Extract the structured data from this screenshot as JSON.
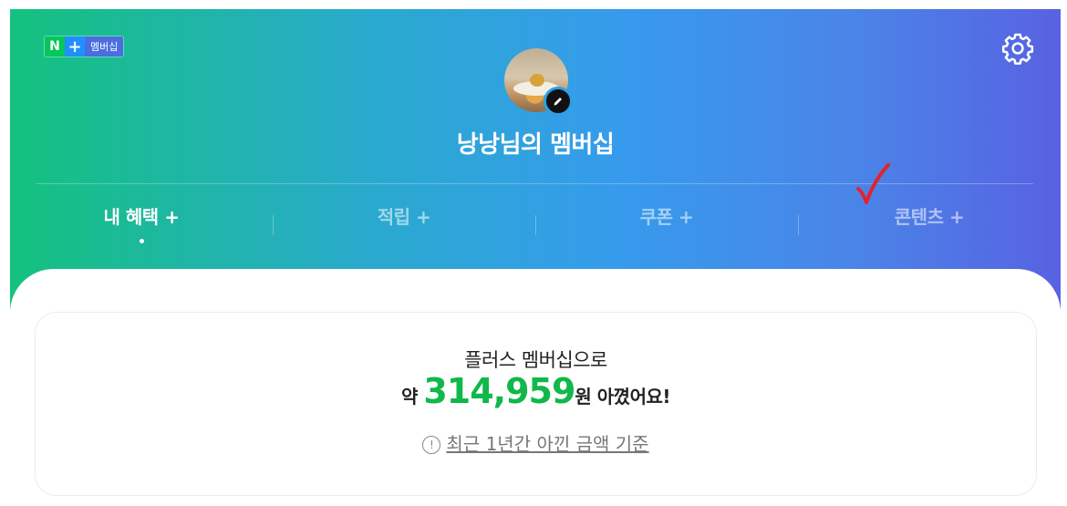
{
  "header": {
    "badge": {
      "n": "N",
      "plus": "+",
      "label": "멤버십"
    },
    "title": "낭낭님의 멤버십",
    "icons": {
      "settings": "gear-icon",
      "edit": "pencil-icon"
    }
  },
  "tabs": [
    {
      "label": "내 혜택",
      "suffix": "+",
      "active": true
    },
    {
      "label": "적립",
      "suffix": "+",
      "active": false
    },
    {
      "label": "쿠폰",
      "suffix": "+",
      "active": false
    },
    {
      "label": "콘텐츠",
      "suffix": "+",
      "active": false
    }
  ],
  "savings": {
    "line1": "플러스 멤버십으로",
    "prefix": "약 ",
    "amount": "314,959",
    "suffix": "원 아꼈어요!",
    "basis": "최근 1년간 아낀 금액 기준",
    "basis_icon": "info-icon"
  },
  "colors": {
    "gradient_start": "#14c27e",
    "gradient_end": "#5862e2",
    "amount": "#10b84a",
    "annotation_check": "#e0242a"
  }
}
